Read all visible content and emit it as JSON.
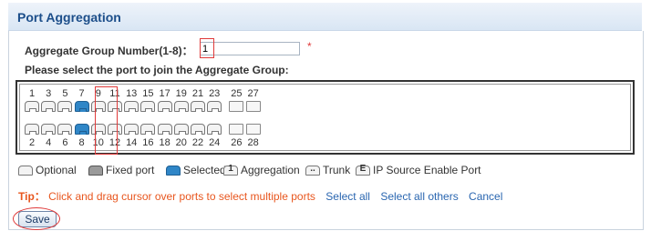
{
  "header": {
    "title": "Port Aggregation"
  },
  "form": {
    "group_label": "Aggregate Group Number(1-8)：",
    "group_value": "1",
    "required_mark": "*",
    "instruction": "Please select the port to join the Aggregate Group:"
  },
  "ports": {
    "top_numbers": [
      "1",
      "3",
      "5",
      "7",
      "9",
      "11",
      "13",
      "15",
      "17",
      "19",
      "21",
      "23",
      "25",
      "27"
    ],
    "bottom_numbers": [
      "2",
      "4",
      "6",
      "8",
      "10",
      "12",
      "14",
      "16",
      "18",
      "20",
      "22",
      "24",
      "26",
      "28"
    ],
    "selected": [
      "7",
      "8"
    ],
    "rj45_ports_per_row": 12,
    "sfp_ports_per_row": 2,
    "colors": {
      "selected": "#2f86c7",
      "fixed": "#9a9a9a",
      "optional": "#f3f3f3"
    }
  },
  "legend": {
    "optional": "Optional",
    "fixed": "Fixed port",
    "selected": "Selected",
    "aggregation": "Aggregation",
    "aggregation_glyph": "1",
    "trunk": "Trunk",
    "trunk_glyph": "..",
    "ip_source": "IP Source Enable Port",
    "ip_source_glyph": "E"
  },
  "tip": {
    "label": "Tip：",
    "text": "Click and drag cursor over ports to select multiple ports",
    "select_all": "Select all",
    "select_all_others": "Select all others",
    "cancel": "Cancel"
  },
  "actions": {
    "save": "Save"
  }
}
